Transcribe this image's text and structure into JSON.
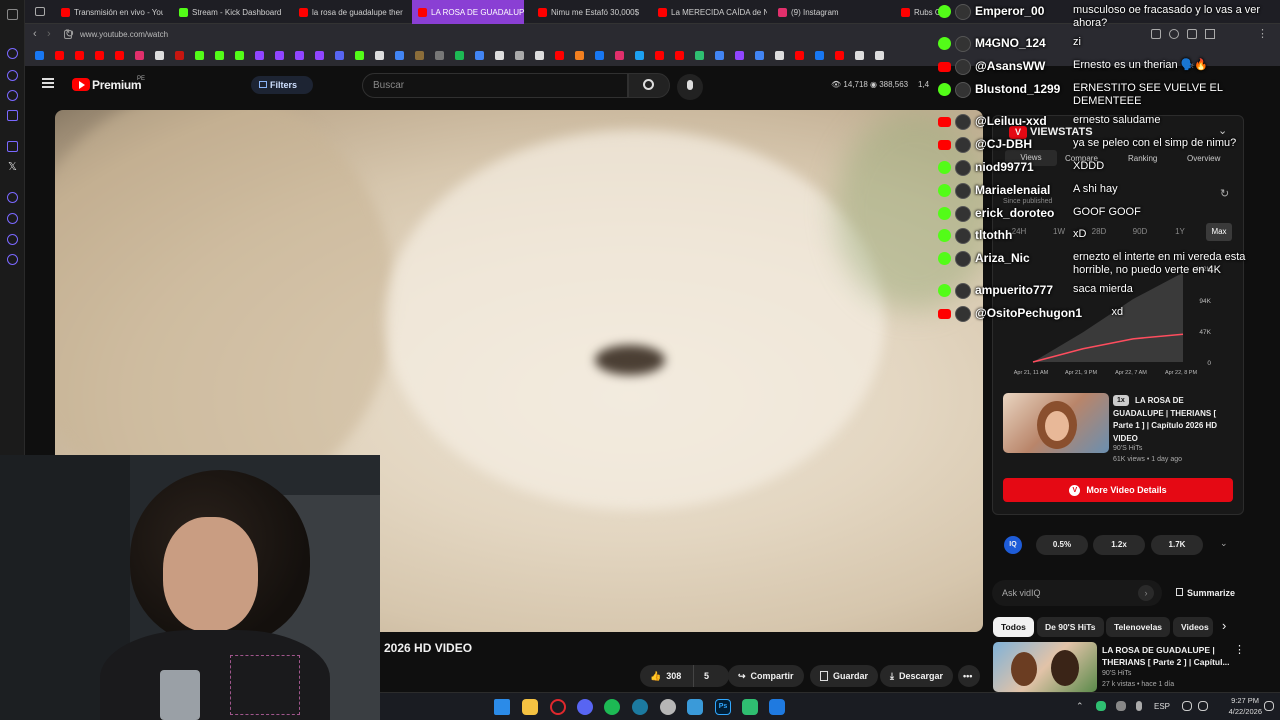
{
  "tabs": [
    {
      "label": "Transmisión en vivo - You",
      "color": "#ff0000"
    },
    {
      "label": "Stream - Kick Dashboard",
      "color": "#53fc18"
    },
    {
      "label": "la rosa de guadalupe ther",
      "color": "#ff0000"
    },
    {
      "label": "LA ROSA DE GUADALUPE",
      "color": "#ff0000"
    },
    {
      "label": "Nimu me Estafó 30,000$",
      "color": "#ff0000"
    },
    {
      "label": "La MERECIDA CAÍDA de N",
      "color": "#ff0000"
    },
    {
      "label": "(9) Instagram",
      "color": "#e1306c"
    },
    {
      "label": "Rubs C",
      "color": "#ff0000"
    }
  ],
  "address": {
    "url": "www.youtube.com/watch"
  },
  "youtube": {
    "logo": "Premium",
    "logo_badge": "PE",
    "filters_label": "Filters",
    "search_placeholder": "Buscar",
    "stat_views": "14,718",
    "stat_subs": "388,563",
    "stat_more": "1,4"
  },
  "video": {
    "title_tail": "2026 HD VIDEO",
    "likes": "308",
    "dislikes": "5",
    "share": "Compartir",
    "save": "Guardar",
    "download": "Descargar"
  },
  "chat": [
    {
      "user": "Emperor_00",
      "msg": "musculoso oe fracasado y lo vas a ver ahora?",
      "badge": "kick"
    },
    {
      "user": "M4GNO_124",
      "msg": "zi",
      "badge": "kick"
    },
    {
      "user": "@AsansWW",
      "msg": "Ernesto es un therian 🗣️🔥",
      "badge": "youtube"
    },
    {
      "user": "Blustond_1299",
      "msg": "ERNESTITO SEE VUELVE EL DEMENTEEE",
      "badge": "kick"
    },
    {
      "user": "@Leiluu-xxd",
      "msg": "ernesto saludame",
      "badge": "youtube"
    },
    {
      "user": "@CJ-DBH",
      "msg": "ya se peleo con el simp de nimu?",
      "badge": "youtube"
    },
    {
      "user": "niod99771",
      "msg": "XDDD",
      "badge": "kick"
    },
    {
      "user": "Mariaelenaial",
      "msg": "A shi hay",
      "badge": "kick"
    },
    {
      "user": "erick_doroteo",
      "msg": "GOOF GOOF",
      "badge": "kick"
    },
    {
      "user": "tltothh",
      "msg": "xD",
      "badge": "kick"
    },
    {
      "user": "Ariza_Nic",
      "msg": "ernezto el interte en mi vereda esta horrible, no puedo verte en 4K",
      "badge": "kick"
    },
    {
      "user": "ampuerito777",
      "msg": "saca mierda",
      "badge": "kick"
    },
    {
      "user": "@OsitoPechugon1",
      "msg": "xd",
      "badge": "youtube"
    }
  ],
  "viewstats": {
    "brand": "VIEWSTATS",
    "tabs": [
      "Views",
      "Compare",
      "Ranking",
      "Overview"
    ],
    "since": "Since published",
    "time_ranges": [
      "24H",
      "1W",
      "28D",
      "90D",
      "1Y",
      "Max"
    ],
    "chart_yticks": [
      "142K",
      "94K",
      "47K",
      "0"
    ],
    "chart_xticks": [
      "Apr 21, 11 AM",
      "Apr 21, 9 PM",
      "Apr 22, 7 AM",
      "Apr 22, 8 PM"
    ],
    "video_multiplier": "1x",
    "video_title": "LA ROSA DE GUADALUPE | THERIANS [ Parte 1 ] | Capítulo 2026 HD VIDEO",
    "video_channel": "90'S HiTs",
    "video_meta": "61K views • 1 day ago",
    "more_details": "More Video Details"
  },
  "vidiq": {
    "logo": "IQ",
    "stats": [
      "0.5%",
      "1.2x",
      "1.7K"
    ],
    "ask_placeholder": "Ask vidIQ",
    "summarize": "Summarize"
  },
  "chips": [
    "Todos",
    "De 90'S HiTs",
    "Telenovelas",
    "Videos"
  ],
  "related": {
    "title": "LA ROSA DE GUADALUPE | THERIANS [ Parte 2 ] | Capítul...",
    "channel": "90'S HiTs",
    "meta": "27 k vistas • hace 1 día"
  },
  "taskbar": {
    "lang": "ESP",
    "time": "9:27 PM",
    "date": "4/22/2026"
  },
  "chart_data": {
    "type": "area",
    "x": [
      "Apr 21, 11 AM",
      "Apr 21, 9 PM",
      "Apr 22, 7 AM",
      "Apr 22, 8 PM"
    ],
    "series": [
      {
        "values": [
          0,
          45000,
          95000,
          135000
        ]
      },
      {
        "values": [
          0,
          20000,
          35000,
          42000
        ]
      }
    ],
    "ylim": [
      0,
      142000
    ],
    "grid": false
  }
}
